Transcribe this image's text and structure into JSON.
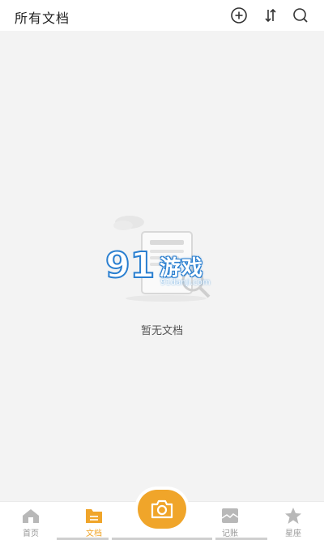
{
  "header": {
    "title": "所有文档",
    "icons": [
      "add-circle-icon",
      "sort-icon",
      "search-icon"
    ]
  },
  "empty_state": {
    "message": "暂无文档"
  },
  "watermark": {
    "brand": "游戏",
    "site": "91danji.com"
  },
  "tabbar": {
    "items": [
      {
        "label": "首页",
        "icon": "home-icon",
        "active": false
      },
      {
        "label": "文档",
        "icon": "document-icon",
        "active": true
      },
      {
        "label": "记账",
        "icon": "ledger-icon",
        "active": false
      },
      {
        "label": "星座",
        "icon": "star-icon",
        "active": false
      }
    ],
    "center_icon": "camera-icon"
  },
  "colors": {
    "accent": "#f0a52a",
    "background": "#f3f3f3",
    "header_bg": "#ffffff",
    "inactive_tab": "#999999"
  }
}
